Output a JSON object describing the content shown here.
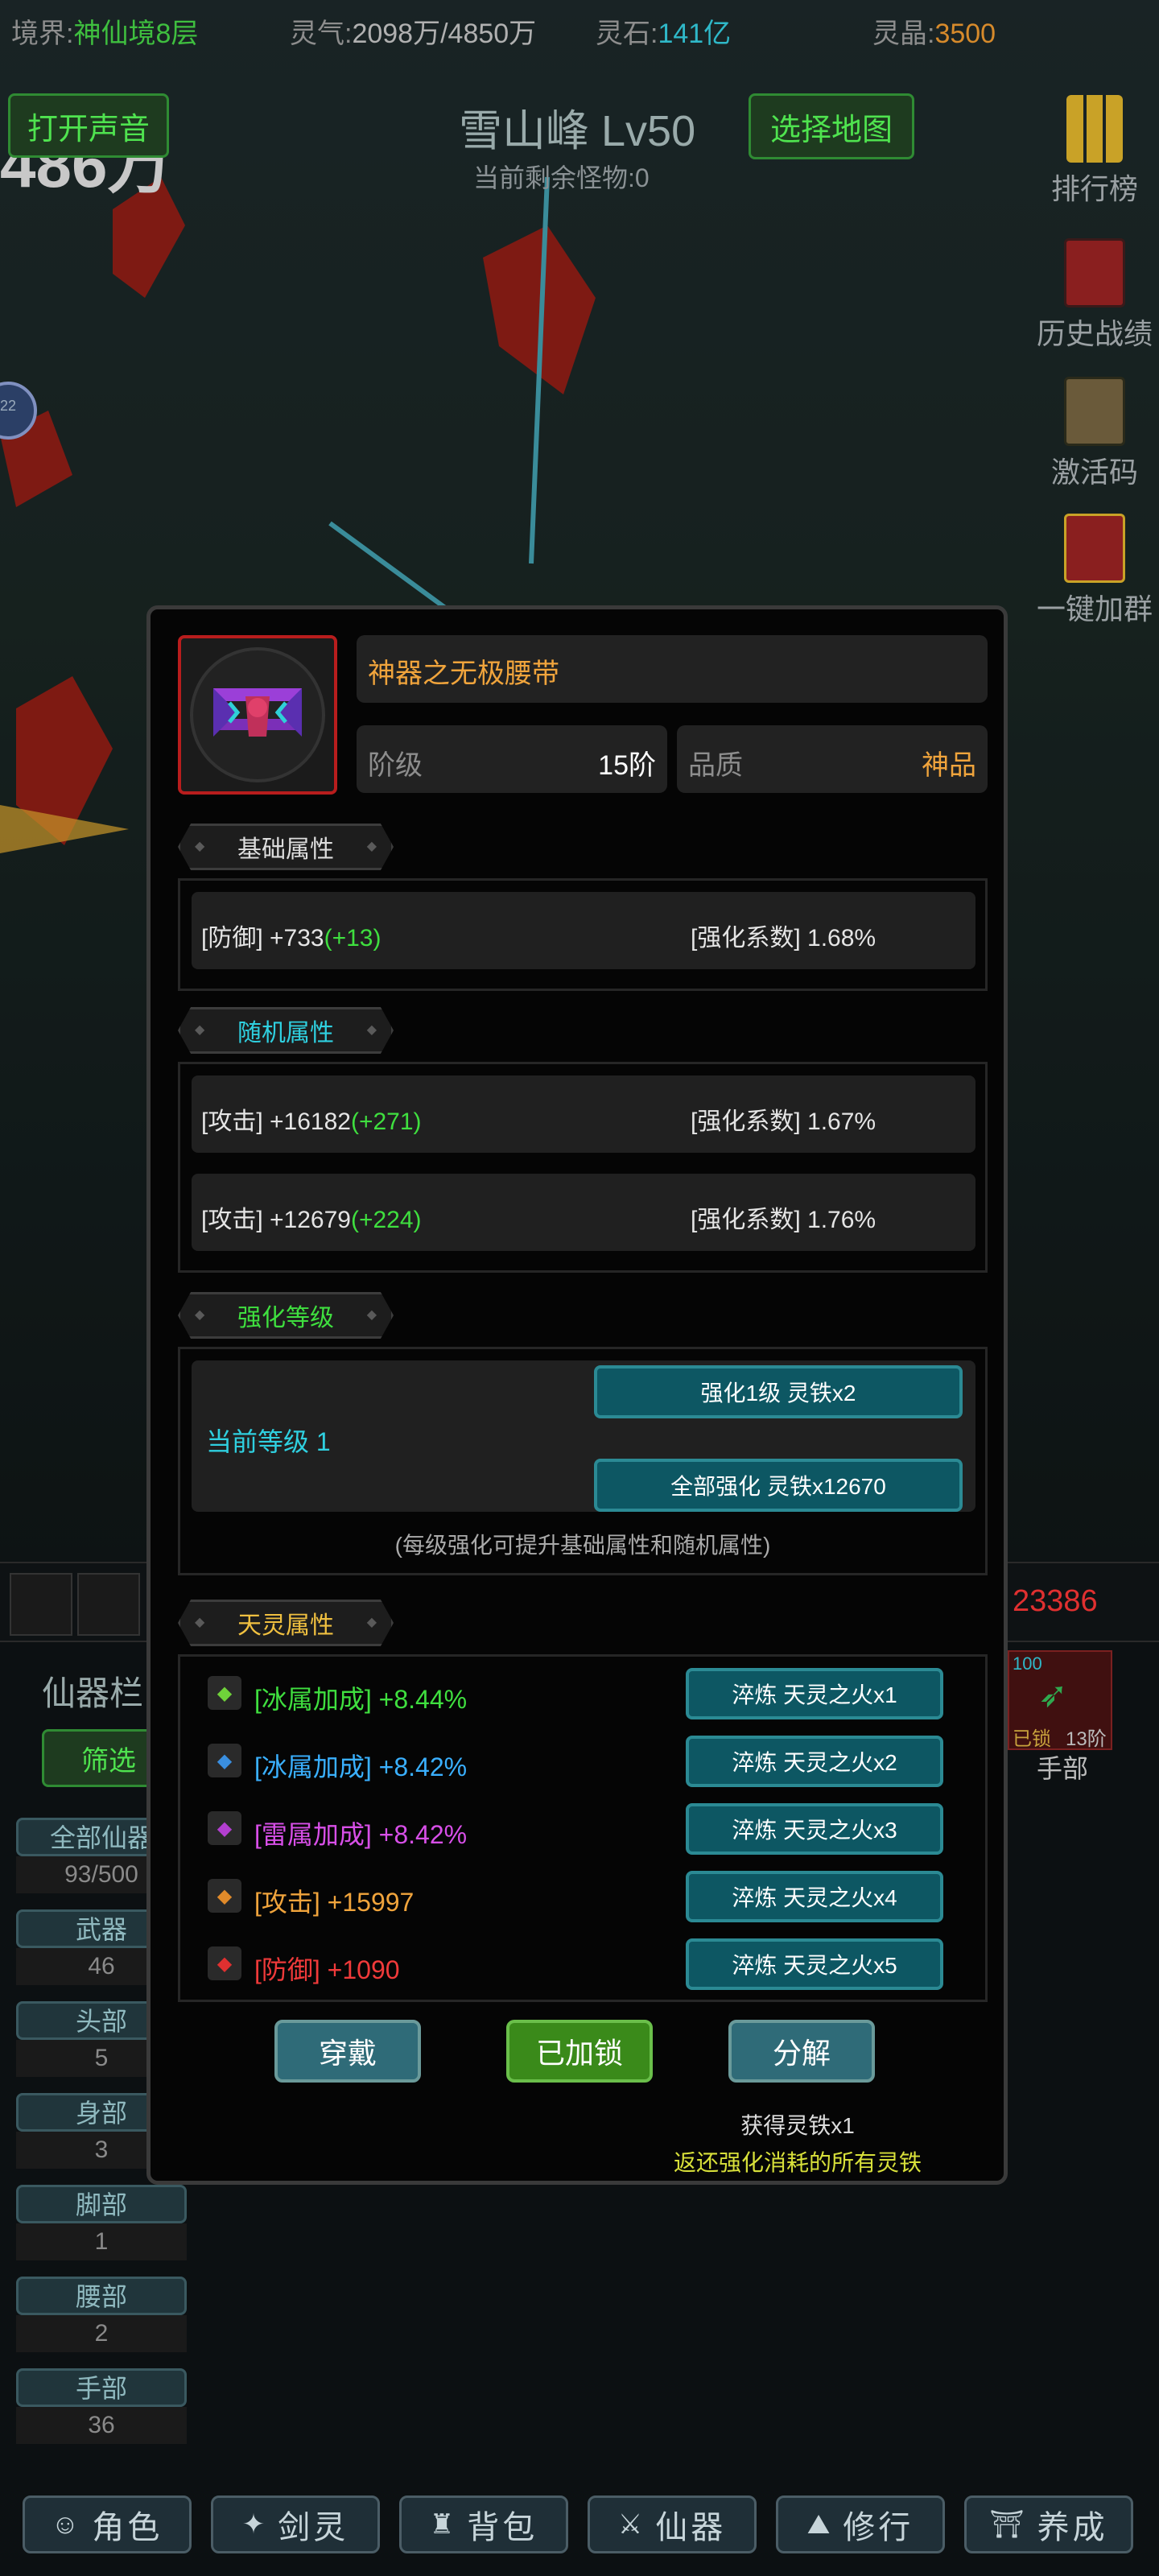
{
  "topbar": {
    "realm_label": "境界:",
    "realm_value": "神仙境8层",
    "qi_label": "灵气:",
    "qi_value": "2098万/4850万",
    "stone_label": "灵石:",
    "stone_value": "141亿",
    "crystal_label": "灵晶:",
    "crystal_value": "3500"
  },
  "scene": {
    "sound_button": "打开声音",
    "big_number": "486万",
    "map_title": "雪山峰 Lv50",
    "monsters_left": "当前剩余怪物:0",
    "select_map_button": "选择地图",
    "side_menu": [
      "排行榜",
      "历史战绩",
      "激活码",
      "一键加群"
    ],
    "round_badge": "22"
  },
  "modal": {
    "item_name": "神器之无极腰带",
    "rank_label": "阶级",
    "rank_value": "15阶",
    "quality_label": "品质",
    "quality_value": "神品",
    "base_section": "基础属性",
    "base_rows": [
      {
        "left": "[防御] +733",
        "plus": "(+13)",
        "right": "[强化系数] 1.68%"
      }
    ],
    "random_section": "随机属性",
    "random_rows": [
      {
        "left": "[攻击] +16182",
        "plus": "(+271)",
        "right": "[强化系数] 1.67%"
      },
      {
        "left": "[攻击] +12679",
        "plus": "(+224)",
        "right": "[强化系数] 1.76%"
      }
    ],
    "enhance_section": "强化等级",
    "current_level": "当前等级 1",
    "enhance_one": "强化1级 灵铁x2",
    "enhance_all": "全部强化 灵铁x12670",
    "enhance_note": "(每级强化可提升基础属性和随机属性)",
    "spirit_section": "天灵属性",
    "spirit_rows": [
      {
        "text": "[冰属加成] +8.44%",
        "color": "#3fdf3f",
        "gem": "#6fd23a",
        "btn": "淬炼 天灵之火x1"
      },
      {
        "text": "[冰属加成] +8.42%",
        "color": "#3ab0ff",
        "gem": "#3a8fe0",
        "btn": "淬炼 天灵之火x2"
      },
      {
        "text": "[雷属加成] +8.42%",
        "color": "#d84fe8",
        "gem": "#b33fd0",
        "btn": "淬炼 天灵之火x3"
      },
      {
        "text": "[攻击] +15997",
        "color": "#f0a43c",
        "gem": "#e08a2a",
        "btn": "淬炼 天灵之火x4"
      },
      {
        "text": "[防御] +1090",
        "color": "#f03a3a",
        "gem": "#e03030",
        "btn": "淬炼 天灵之火x5"
      }
    ],
    "wear_button": "穿戴",
    "lock_button": "已加锁",
    "decompose_button": "分解",
    "reward_line1": "获得灵铁x1",
    "reward_line2": "返还强化消耗的所有灵铁"
  },
  "lower": {
    "red_number": "23386",
    "panel_title": "仙器栏",
    "filter_button": "筛选",
    "right_slot": {
      "badge": "100",
      "locked": "已锁",
      "rank": "13阶",
      "label": "手部"
    },
    "categories": [
      {
        "label": "全部仙器",
        "count": "93/500"
      },
      {
        "label": "武器",
        "count": "46"
      },
      {
        "label": "头部",
        "count": "5"
      },
      {
        "label": "身部",
        "count": "3"
      },
      {
        "label": "脚部",
        "count": "1"
      },
      {
        "label": "腰部",
        "count": "2"
      },
      {
        "label": "手部",
        "count": "36"
      }
    ]
  },
  "nav": [
    {
      "label": "角色",
      "icon": "character-icon"
    },
    {
      "label": "剑灵",
      "icon": "sword-spirit-icon"
    },
    {
      "label": "背包",
      "icon": "bag-icon"
    },
    {
      "label": "仙器",
      "icon": "artifact-icon"
    },
    {
      "label": "修行",
      "icon": "cultivation-icon"
    },
    {
      "label": "养成",
      "icon": "nurture-icon"
    }
  ]
}
